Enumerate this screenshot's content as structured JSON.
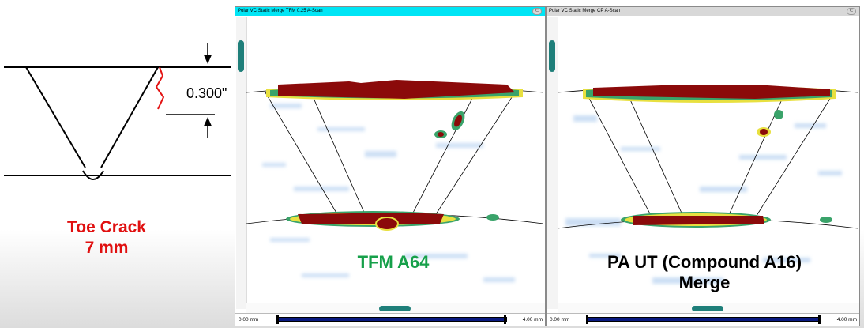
{
  "diagram": {
    "dimension_label": "0.300\"",
    "caption_line1": "Toe Crack",
    "caption_line2": "7 mm"
  },
  "panels": [
    {
      "title": "Polar VC Static Merge TFM 0.25 A-Scan",
      "titlebar_color": "#00e5f5",
      "overlay_label": "TFM A64",
      "overlay_color": "#16a04a",
      "axis_min": "0.00 mm",
      "axis_max": "4.00 mm"
    },
    {
      "title": "Polar VC Static Merge CP A-Scan",
      "titlebar_color": "#d8d8d8",
      "overlay_label_line1": "PA UT (Compound A16)",
      "overlay_label_line2": "Merge",
      "overlay_color": "#000000",
      "axis_min": "0.00 mm",
      "axis_max": "4.00 mm"
    }
  ],
  "colors": {
    "hot": "#8b0a0a",
    "warm": "#e8e040",
    "edge": "#3aa36a",
    "cool": "#a8c8ee",
    "scroll_thumb": "#1f7f7a",
    "range_bar": "#0a1a80"
  }
}
